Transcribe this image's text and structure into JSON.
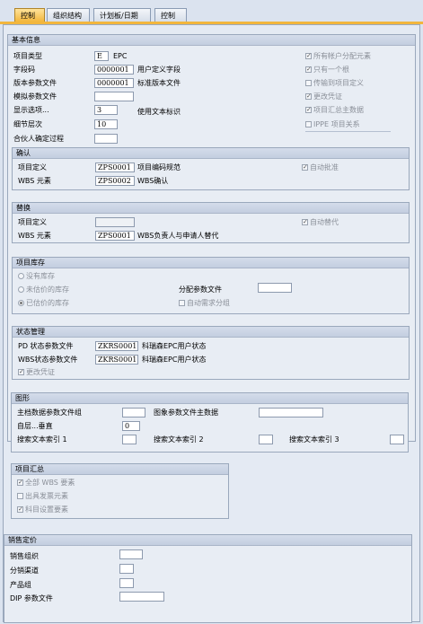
{
  "tabs": [
    "控制",
    "组织结构",
    "计划板/日期",
    "控制"
  ],
  "basic": {
    "title": "基本信息",
    "project_type_label": "项目类型",
    "project_type_value": "E",
    "project_type_text": "EPC",
    "field_key_label": "字段码",
    "field_key_value": "0000001",
    "field_key_text": "用户定义字段",
    "version_profile_label": "版本参数文件",
    "version_profile_value": "0000001",
    "version_profile_text": "标准版本文件",
    "sim_profile_label": "模拟参数文件",
    "display_option_label": "显示选项...",
    "display_option_value": "3",
    "display_option_text": "使用文本标识",
    "level_label": "细节层次",
    "level_value": "10",
    "partner_label": "合伙人确定过程",
    "checkboxes": [
      {
        "label": "所有帐户分配元素",
        "checked": true
      },
      {
        "label": "只有一个根",
        "checked": true
      },
      {
        "label": "传输到项目定义",
        "checked": false
      },
      {
        "label": "更改凭证",
        "checked": true
      },
      {
        "label": "项目汇总主数据",
        "checked": true
      },
      {
        "label": "IPPE 项目关系",
        "checked": false
      }
    ]
  },
  "confirm": {
    "title": "确认",
    "proj_def_label": "项目定义",
    "proj_def_value": "ZPS0001",
    "proj_def_text": "项目编码规范",
    "wbs_label": "WBS 元素",
    "wbs_value": "ZPS0002",
    "wbs_text": "WBS确认",
    "auto_approve": "自动批准"
  },
  "replace": {
    "title": "替换",
    "proj_def_label": "项目定义",
    "wbs_label": "WBS 元素",
    "wbs_value": "ZPS0001",
    "wbs_text": "WBS负责人与申请人替代",
    "auto_replace": "自动替代"
  },
  "stock": {
    "title": "项目库存",
    "radios": [
      {
        "label": "没有库存",
        "on": false
      },
      {
        "label": "未估价的库存",
        "on": false
      },
      {
        "label": "已估价的库存",
        "on": true
      }
    ],
    "alloc_label": "分配参数文件",
    "auto_req": "自动需求分组"
  },
  "status": {
    "title": "状态管理",
    "pd_label": "PD 状态参数文件",
    "pd_value": "ZKRS0001",
    "pd_text": "科瑞森EPC用户状态",
    "wbs_label": "WBS状态参数文件",
    "wbs_value": "ZKRS0001",
    "wbs_text": "科瑞森EPC用户状态",
    "change_doc": "更改凭证"
  },
  "graphics": {
    "title": "图形",
    "master_group_label": "主档数据参数文件组",
    "image_master_label": "图象参数文件主数据",
    "top_down_label": "自层...垂直",
    "top_down_value": "0",
    "search1": "搜索文本索引 1",
    "search2": "搜索文本索引 2",
    "search3": "搜索文本索引 3"
  },
  "summary": {
    "title": "项目汇总",
    "items": [
      {
        "label": "全部 WBS 要素",
        "checked": true
      },
      {
        "label": "出具发票元素",
        "checked": false
      },
      {
        "label": "科目设置要素",
        "checked": true
      }
    ]
  },
  "sales": {
    "title": "销售定价",
    "org_label": "销售组织",
    "channel_label": "分销渠道",
    "division_label": "产品组",
    "dip_label": "DIP 参数文件"
  }
}
